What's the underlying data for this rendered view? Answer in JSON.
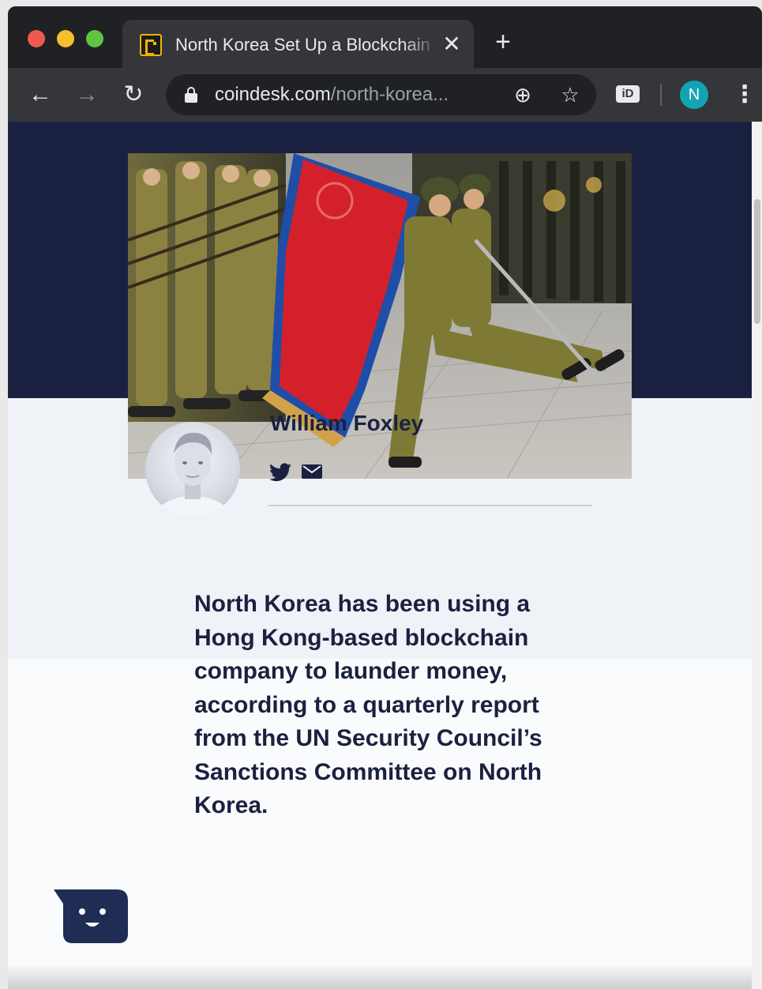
{
  "browser": {
    "tab": {
      "title": "North Korea Set Up a Blockchain",
      "close_glyph": "✕",
      "favicon": "coindesk-favicon"
    },
    "new_tab_glyph": "+",
    "toolbar": {
      "back_glyph": "←",
      "forward_glyph": "→",
      "reload_glyph": "↻",
      "url_host": "coindesk.com",
      "url_path": "/north-korea...",
      "add_glyph": "⊕",
      "star_glyph": "☆",
      "extension_label": "iD",
      "profile_initial": "N",
      "menu_glyph": "⋮"
    },
    "colors": {
      "chrome_dark": "#202124",
      "chrome_tab": "#35363a",
      "profile": "#12a4b4"
    }
  },
  "article": {
    "hero_image": "north-korean-military-parade-flag-photo",
    "author": {
      "name": "William Foxley",
      "avatar": "author-photo",
      "social": [
        "twitter-icon",
        "mail-icon"
      ]
    },
    "lede": "North Korea has been using a Hong Kong-based blockchain company to launder money, according to a quarterly report from the UN Security Council’s Sanctions Committee on North Korea.",
    "colors": {
      "navy": "#1a2140",
      "author_bg": "#eff2f7"
    }
  },
  "chat_widget": {
    "icon": "chat-bot-icon"
  }
}
